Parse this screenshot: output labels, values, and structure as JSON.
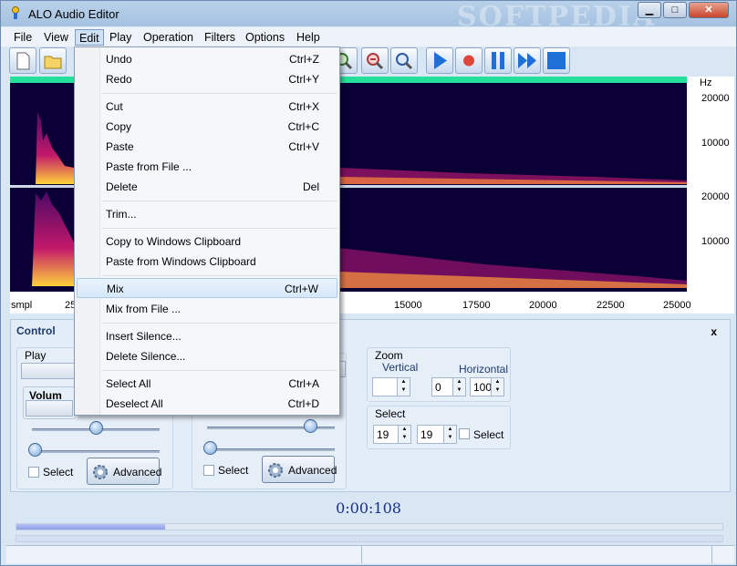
{
  "window": {
    "title": "ALO Audio Editor",
    "watermark": "SOFTPEDIA"
  },
  "menubar": [
    "File",
    "View",
    "Edit",
    "Play",
    "Operation",
    "Filters",
    "Options",
    "Help"
  ],
  "edit_menu": [
    {
      "label": "Undo",
      "shortcut": "Ctrl+Z"
    },
    {
      "label": "Redo",
      "shortcut": "Ctrl+Y"
    },
    {
      "label": "Cut",
      "shortcut": "Ctrl+X"
    },
    {
      "label": "Copy",
      "shortcut": "Ctrl+C"
    },
    {
      "label": "Paste",
      "shortcut": "Ctrl+V"
    },
    {
      "label": "Paste from File ...",
      "shortcut": ""
    },
    {
      "label": "Delete",
      "shortcut": "Del"
    },
    {
      "label": "Trim...",
      "shortcut": ""
    },
    {
      "label": "Copy to Windows Clipboard",
      "shortcut": ""
    },
    {
      "label": "Paste from Windows Clipboard",
      "shortcut": ""
    },
    {
      "label": "Mix",
      "shortcut": "Ctrl+W"
    },
    {
      "label": "Mix from File ...",
      "shortcut": ""
    },
    {
      "label": "Insert Silence...",
      "shortcut": ""
    },
    {
      "label": "Delete Silence...",
      "shortcut": ""
    },
    {
      "label": "Select All",
      "shortcut": "Ctrl+A"
    },
    {
      "label": "Deselect All",
      "shortcut": "Ctrl+D"
    }
  ],
  "spectrogram": {
    "hz_label": "Hz",
    "hz_ticks_top": [
      "20000",
      "10000"
    ],
    "hz_ticks_bottom": [
      "20000",
      "10000"
    ],
    "x_unit": "smpl",
    "x_ticks": [
      "25",
      "15000",
      "17500",
      "20000",
      "22500",
      "25000"
    ]
  },
  "control": {
    "title": "Control",
    "close": "x",
    "play_label": "Play",
    "volume_label": "Volum",
    "select_label": "Select",
    "advanced_label": "Advanced",
    "zoom": {
      "title": "Zoom",
      "vertical": "Vertical",
      "horizontal": "Horizontal",
      "vertical_value": "",
      "h_value1": "0",
      "h_value2": "100"
    },
    "select_group": {
      "title": "Select",
      "from": "19",
      "to": "19",
      "check_label": "Select"
    }
  },
  "timer": "0:00:108",
  "progress_fraction": 0.21,
  "colors": {
    "accent": "#25e09a",
    "timer": "#1a2f8a"
  }
}
